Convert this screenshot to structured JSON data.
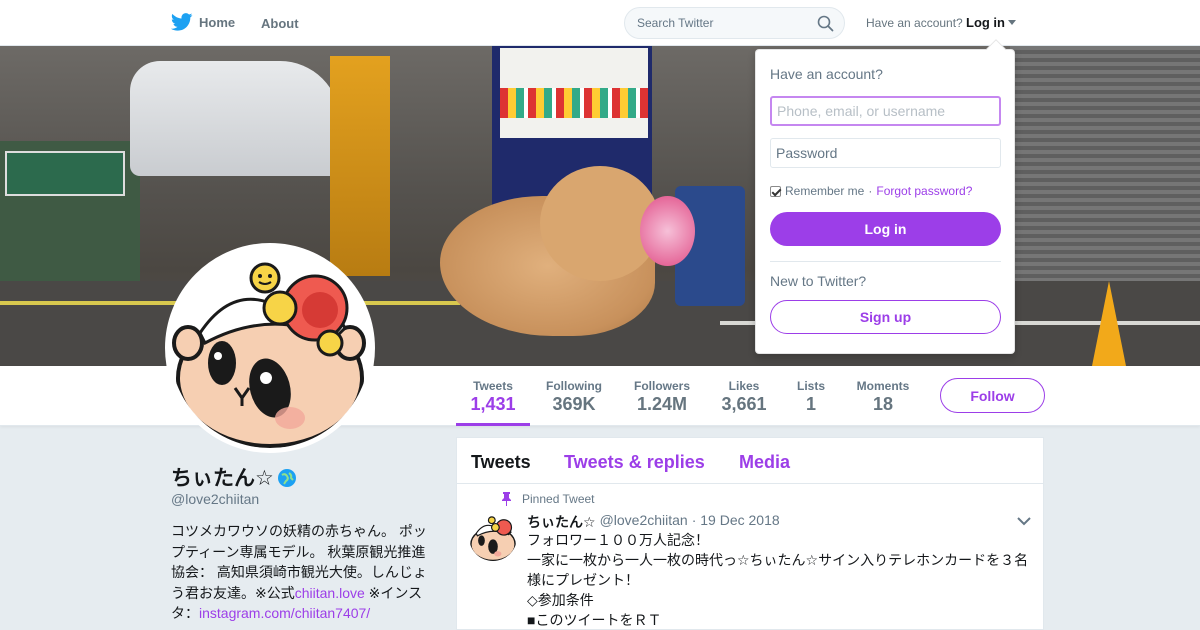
{
  "nav": {
    "home": "Home",
    "about": "About",
    "search_placeholder": "Search Twitter",
    "have_account": "Have an account?",
    "login": "Log in"
  },
  "stats": [
    {
      "label": "Tweets",
      "value": "1,431"
    },
    {
      "label": "Following",
      "value": "369K"
    },
    {
      "label": "Followers",
      "value": "1.24M"
    },
    {
      "label": "Likes",
      "value": "3,661"
    },
    {
      "label": "Lists",
      "value": "1"
    },
    {
      "label": "Moments",
      "value": "18"
    }
  ],
  "follow_label": "Follow",
  "profile": {
    "name": "ちぃたん☆",
    "handle": "@love2chiitan",
    "bio_text": "コツメカワウソの妖精の赤ちゃん。 ポップティーン専属モデル。 秋葉原観光推進協会： 高知県須崎市観光大使。しんじょう君お友達。※公式",
    "bio_link1": "chiitan.love",
    "bio_mid": " ※インスタ：",
    "bio_link2": "instagram.com/chiitan7407/"
  },
  "timeline": {
    "tabs": [
      "Tweets",
      "Tweets & replies",
      "Media"
    ],
    "pinned_label": "Pinned Tweet",
    "tweet": {
      "name": "ちぃたん☆",
      "handle": "@love2chiitan",
      "date": "· 19 Dec 2018",
      "lines": [
        "フォロワー１００万人記念！",
        "一家に一枚から一人一枚の時代っ☆ちぃたん☆サイン入りテレホンカードを３名様にプレゼント！",
        "◇参加条件",
        "■このツイートをＲＴ"
      ]
    }
  },
  "login_dropdown": {
    "title": "Have an account?",
    "username_placeholder": "Phone, email, or username",
    "password_placeholder": "Password",
    "remember": "Remember me",
    "separator": "·",
    "forgot": "Forgot password?",
    "login_button": "Log in",
    "new_to": "New to Twitter?",
    "signup_button": "Sign up"
  },
  "colors": {
    "accent": "#9c3ee8",
    "twitter_blue": "#1da1f2",
    "background": "#e6ecf0"
  }
}
